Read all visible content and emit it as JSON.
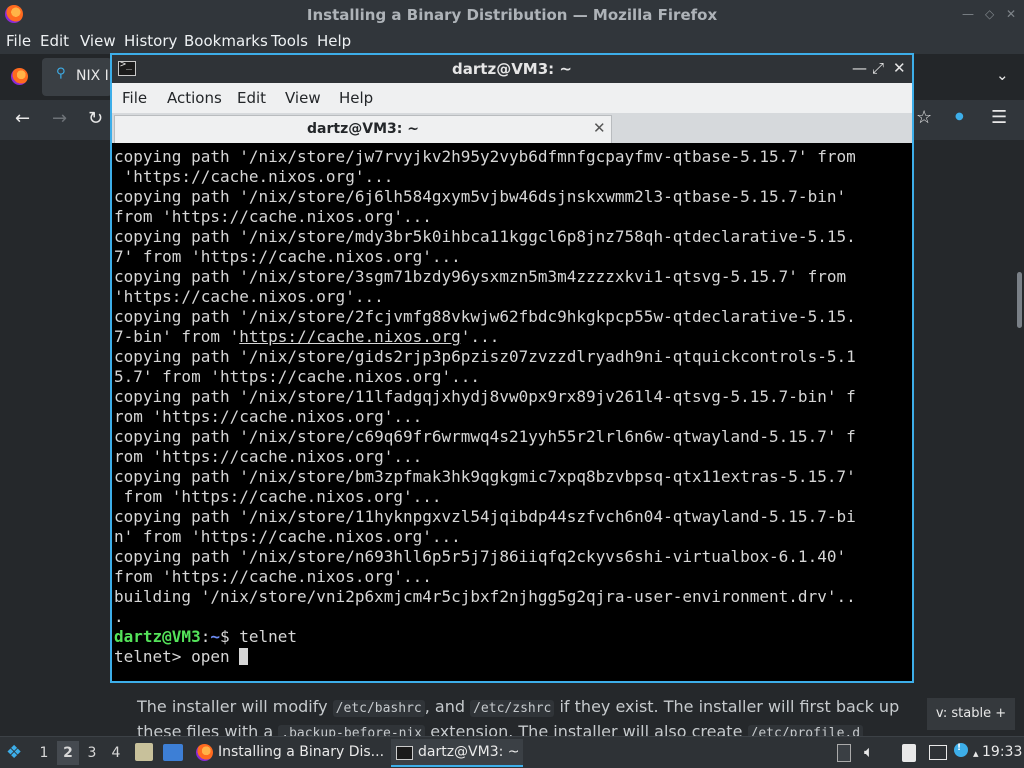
{
  "firefox": {
    "window_title": "Installing a Binary Distribution — Mozilla Firefox",
    "menu": [
      "File",
      "Edit",
      "View",
      "History",
      "Bookmarks",
      "Tools",
      "Help"
    ],
    "tab_label": "NIX I",
    "page_text": {
      "line1_pre": "The installer will modify",
      "code1": "/etc/bashrc",
      "line1_mid": ", and",
      "code2": "/etc/zshrc",
      "line1_post": "if they exist. The installer will first back up",
      "line2_pre": "these files with a",
      "code3": ".backup-before-nix",
      "line2_post": "extension. The installer will also create",
      "code4": "/etc/profile.d"
    },
    "version_badge": "v: stable +"
  },
  "terminal": {
    "window_title": "dartz@VM3: ~",
    "menu": [
      "File",
      "Actions",
      "Edit",
      "View",
      "Help"
    ],
    "tab_label": "dartz@VM3: ~",
    "output_lines": [
      "copying path '/nix/store/jw7rvyjkv2h95y2vyb6dfmnfgcpayfmv-qtbase-5.15.7' from",
      " 'https://cache.nixos.org'...",
      "copying path '/nix/store/6j6lh584gxym5vjbw46dsjnskxwmm2l3-qtbase-5.15.7-bin'",
      "from 'https://cache.nixos.org'...",
      "copying path '/nix/store/mdy3br5k0ihbca11kggcl6p8jnz758qh-qtdeclarative-5.15.",
      "7' from 'https://cache.nixos.org'...",
      "copying path '/nix/store/3sgm71bzdy96ysxmzn5m3m4zzzzxkvi1-qtsvg-5.15.7' from",
      "'https://cache.nixos.org'..."
    ],
    "link_line_pre": "copying path '/nix/store/2fcjvmfg88vkwjw62fbdc9hkgkpcp55w-qtdeclarative-5.15.",
    "link_line_a": "7-bin' from '",
    "link_url": "https://cache.nixos.org",
    "link_line_b": "'...",
    "output_lines_2": [
      "copying path '/nix/store/gids2rjp3p6pzisz07zvzzdlryadh9ni-qtquickcontrols-5.1",
      "5.7' from 'https://cache.nixos.org'...",
      "copying path '/nix/store/11lfadgqjxhydj8vw0px9rx89jv261l4-qtsvg-5.15.7-bin' f",
      "rom 'https://cache.nixos.org'...",
      "copying path '/nix/store/c69q69fr6wrmwq4s21yyh55r2lrl6n6w-qtwayland-5.15.7' f",
      "rom 'https://cache.nixos.org'...",
      "copying path '/nix/store/bm3zpfmak3hk9qgkgmic7xpq8bzvbpsq-qtx11extras-5.15.7'",
      " from 'https://cache.nixos.org'...",
      "copying path '/nix/store/11hyknpgxvzl54jqibdp44szfvch6n04-qtwayland-5.15.7-bi",
      "n' from 'https://cache.nixos.org'...",
      "copying path '/nix/store/n693hll6p5r5j7j86iiqfq2ckyvs6shi-virtualbox-6.1.40'",
      "from 'https://cache.nixos.org'...",
      "building '/nix/store/vni2p6xmjcm4r5cjbxf2njhgg5g2qjra-user-environment.drv'..",
      "."
    ],
    "prompt_user": "dartz@VM3",
    "prompt_sep": ":",
    "prompt_path": "~",
    "prompt_dollar": "$ ",
    "prompt_cmd": "telnet",
    "telnet_prompt": "telnet> open "
  },
  "taskbar": {
    "desktops": [
      "1",
      "2",
      "3",
      "4"
    ],
    "active_desktop": "2",
    "tasks": [
      {
        "label": "Installing a Binary Dis..."
      },
      {
        "label": "dartz@VM3: ~"
      }
    ],
    "clock": "19:33"
  },
  "colors": {
    "accent": "#3daee9",
    "prompt_user": "#54e35a",
    "prompt_path": "#6c8cf5"
  }
}
